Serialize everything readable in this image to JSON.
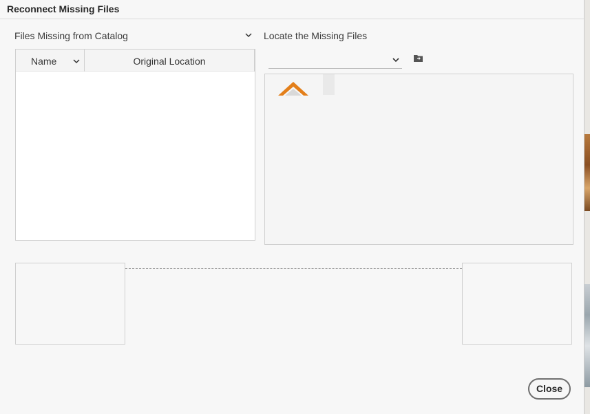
{
  "window": {
    "title": "Reconnect Missing Files"
  },
  "missing_panel": {
    "label": "Files Missing from Catalog",
    "chevron_icon": "chevron-down-icon",
    "columns": [
      {
        "label": "Name",
        "sort_icon": "chevron-down-icon"
      },
      {
        "label": "Original Location"
      }
    ],
    "rows": []
  },
  "locate_panel": {
    "label": "Locate the Missing Files",
    "folder_select": {
      "value": "",
      "icon": "chevron-down-icon"
    },
    "browse_icon": "folder-browse-icon",
    "thumbnail_icon": "photo-thumbnail-icon"
  },
  "footer": {
    "close_label": "Close"
  },
  "colors": {
    "accent": "#e37f1a",
    "dialog_bg": "#f7f7f7",
    "border": "#cfcfcf"
  }
}
